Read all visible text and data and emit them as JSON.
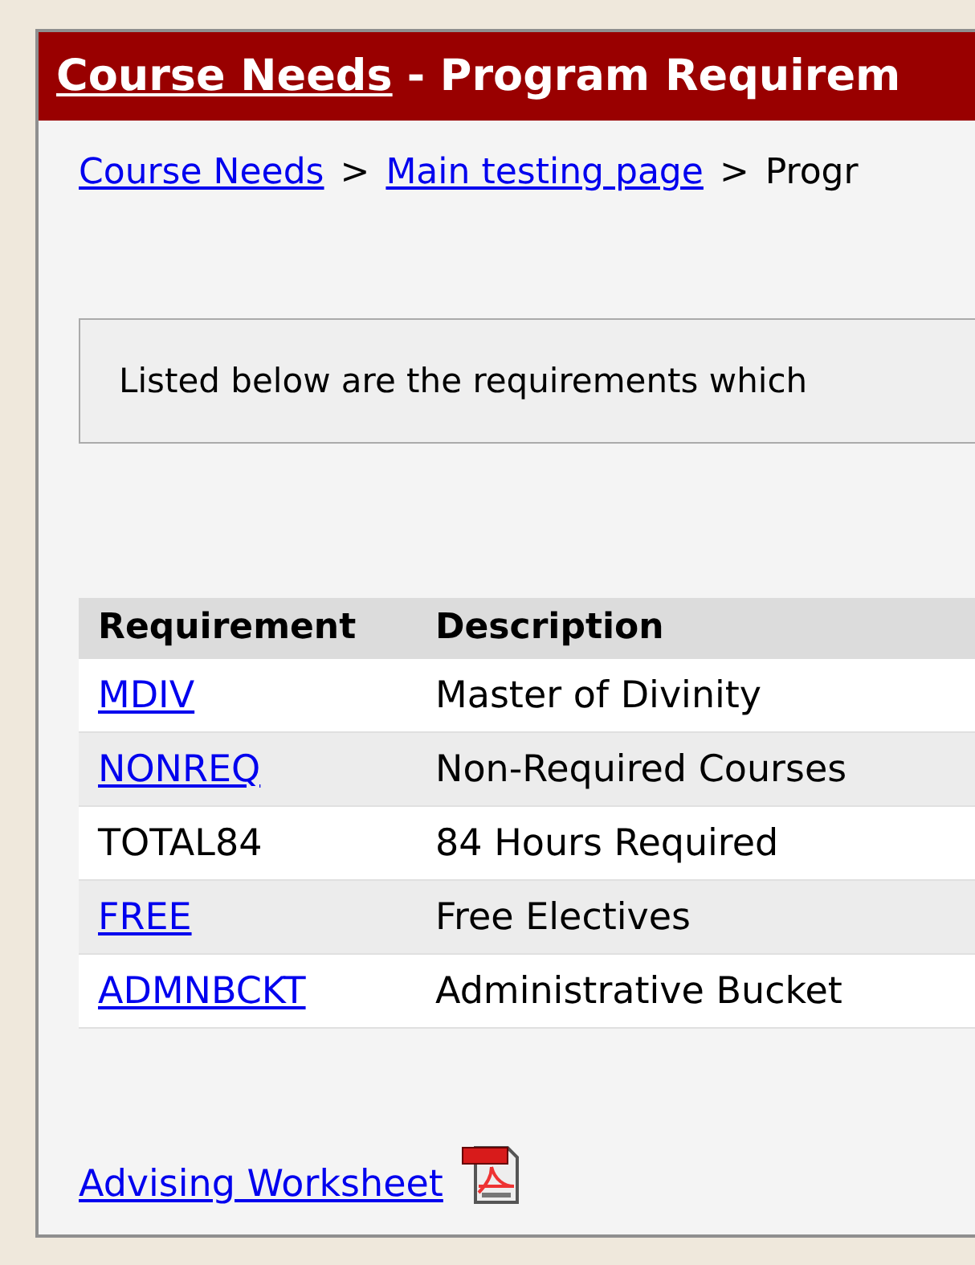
{
  "header": {
    "link": "Course Needs",
    "title": "- Program Requirem"
  },
  "breadcrumb": [
    {
      "label": "Course Needs",
      "kind": "link"
    },
    {
      "label": ">",
      "kind": "separator"
    },
    {
      "label": "Main testing page",
      "kind": "link"
    },
    {
      "label": ">",
      "kind": "separator"
    },
    {
      "label": "Progr",
      "kind": "text"
    }
  ],
  "info_box": {
    "text": "Listed below are the requirements which"
  },
  "table": {
    "columns": [
      "Requirement",
      "Description"
    ],
    "rows": [
      {
        "requirement": "MDIV",
        "description": "Master of Divinity",
        "kind": "link"
      },
      {
        "requirement": "NONREQ",
        "description": "Non-Required Courses",
        "kind": "link"
      },
      {
        "requirement": "TOTAL84",
        "description": "84 Hours Required",
        "kind": "text"
      },
      {
        "requirement": "FREE",
        "description": "Free Electives",
        "kind": "link"
      },
      {
        "requirement": "ADMNBCKT",
        "description": "Administrative Bucket",
        "kind": "link"
      }
    ]
  },
  "footer_link": {
    "label": "Advising Worksheet"
  }
}
